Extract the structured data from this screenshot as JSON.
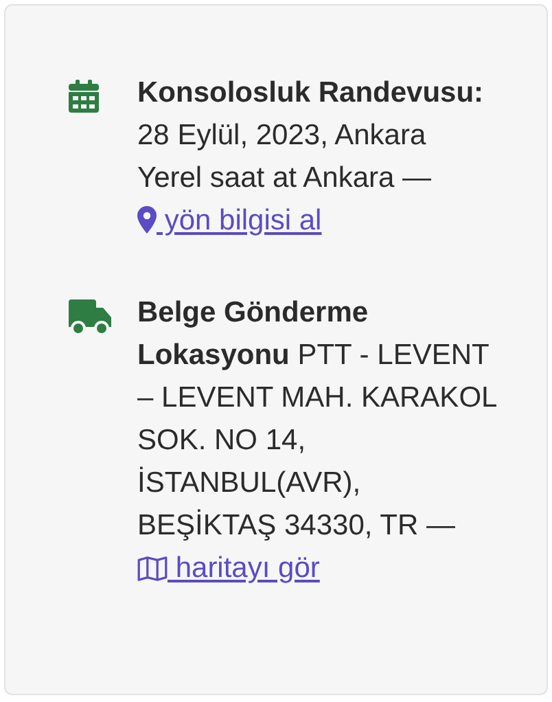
{
  "items": [
    {
      "kind": "appointment",
      "label": "Konsolosluk Randevusu:",
      "text": "28 Eylül, 2023, Ankara Yerel saat at Ankara —",
      "link": {
        "text": " yön bilgisi al"
      }
    },
    {
      "kind": "shipping",
      "label": "Belge Gönderme Lokasyonu",
      "text": "PTT - LEVENT – LEVENT MAH. KARAKOL SOK. NO 14, İSTANBUL(AVR), BEŞİKTAŞ 34330, TR —",
      "link": {
        "text": " haritayı gör"
      }
    }
  ]
}
